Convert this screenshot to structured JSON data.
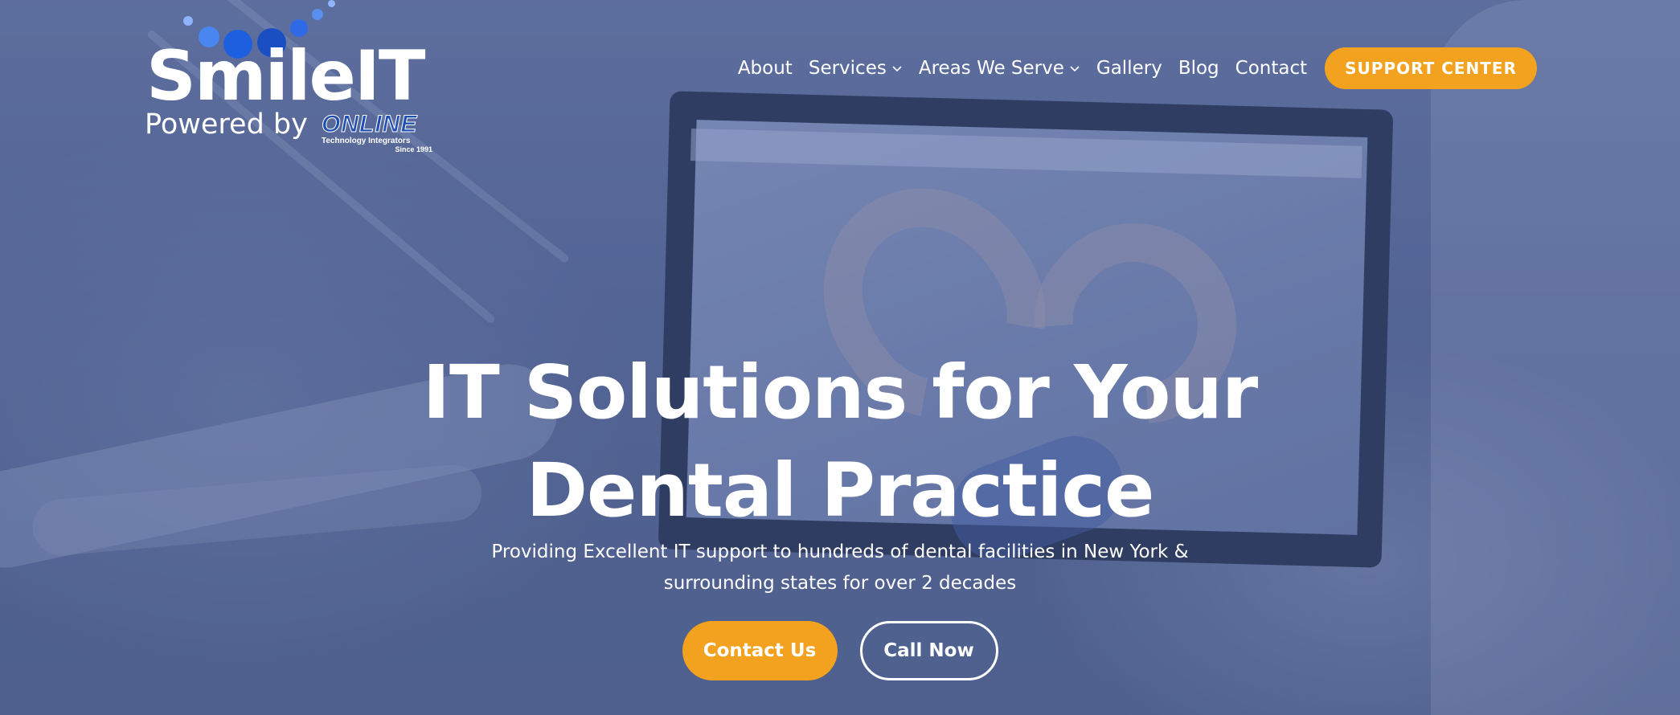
{
  "brand": {
    "logo_smile": "Smile",
    "logo_it": "IT",
    "powered_by": "Powered by",
    "online": "ONLINE",
    "online_sub": "Technology Integrators",
    "online_since": "Since 1991"
  },
  "nav": {
    "items": [
      {
        "label": "About",
        "has_dropdown": false
      },
      {
        "label": "Services",
        "has_dropdown": true
      },
      {
        "label": "Areas We Serve",
        "has_dropdown": true
      },
      {
        "label": "Gallery",
        "has_dropdown": false
      },
      {
        "label": "Blog",
        "has_dropdown": false
      },
      {
        "label": "Contact",
        "has_dropdown": false
      }
    ],
    "support_label": "SUPPORT CENTER"
  },
  "hero": {
    "title_line1": "IT Solutions for Your",
    "title_line2": "Dental Practice",
    "subtitle": "Providing Excellent IT support to hundreds of dental facilities in New York & surrounding states for over 2 decades",
    "primary_cta": "Contact Us",
    "secondary_cta": "Call Now"
  },
  "colors": {
    "accent": "#f2a21e",
    "logo_blue": "#1e5fe0",
    "overlay": "#5a6b95"
  },
  "icons": {
    "dropdown": "chevron-down-icon"
  }
}
